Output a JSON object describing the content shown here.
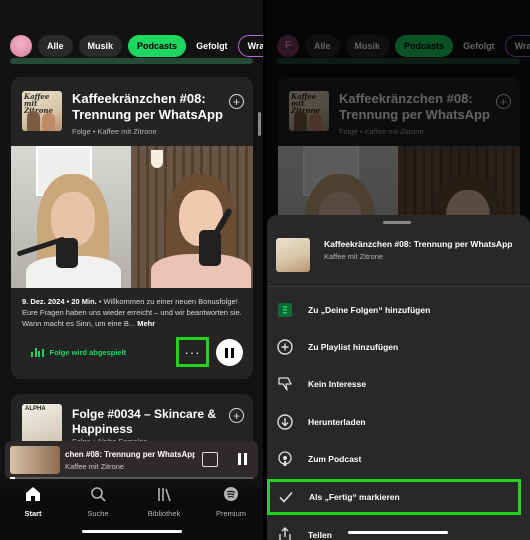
{
  "filters": {
    "chips": [
      "Alle",
      "Musik",
      "Podcasts",
      "Gefolgt",
      "Wrapp"
    ],
    "active": "Podcasts"
  },
  "left": {
    "episode": {
      "title": "Kaffeekränzchen #08: Trennung per WhatsApp",
      "subtitle": "Folge • Kaffee mit Zitrone",
      "cover_text": "Kaffee mit Zitrone",
      "meta": "9. Dez. 2024 • 20 Min.",
      "description": " • Willkommen zu einer neuen Bonusfolge! Eure Fragen haben uns wieder erreicht – und wir beantworten sie. Wann macht es Sinn, um eine B...",
      "more": "Mehr",
      "playing_label": "Folge wird abgespielt",
      "more_button": "···"
    },
    "episode2": {
      "title": "Folge #0034 – Skincare & Happiness",
      "subtitle": "Folge • Alpha Females",
      "cover_text": "ALPHA"
    },
    "mini_player": {
      "title": "chen #08: Trennung per WhatsApp",
      "subtitle": "Kaffee mit Zitrone",
      "progress": 0.02
    },
    "nav": [
      {
        "label": "Start",
        "icon": "home-icon"
      },
      {
        "label": "Suche",
        "icon": "search-icon"
      },
      {
        "label": "Bibliothek",
        "icon": "library-icon"
      },
      {
        "label": "Premium",
        "icon": "spotify-icon"
      }
    ]
  },
  "right": {
    "avatar_letter": "F",
    "sheet": {
      "title": "Kaffeekränzchen #08: Trennung per WhatsApp",
      "subtitle": "Kaffee mit Zitrone",
      "items": [
        {
          "label": "Zu „Deine Folgen“ hinzufügen",
          "icon": "your-episodes-icon"
        },
        {
          "label": "Zu Playlist hinzufügen",
          "icon": "add-circle-icon"
        },
        {
          "label": "Kein Interesse",
          "icon": "thumbs-down-icon"
        },
        {
          "label": "Herunterladen",
          "icon": "download-icon"
        },
        {
          "label": "Zum Podcast",
          "icon": "podcast-icon"
        },
        {
          "label": "Als „Fertig“ markieren",
          "icon": "checkmark-icon"
        },
        {
          "label": "Teilen",
          "icon": "share-icon"
        }
      ]
    }
  },
  "colors": {
    "accent": "#1ed760",
    "highlight_box": "#22d41d",
    "background": "#121212",
    "card": "#242424",
    "sheet": "#282828"
  }
}
